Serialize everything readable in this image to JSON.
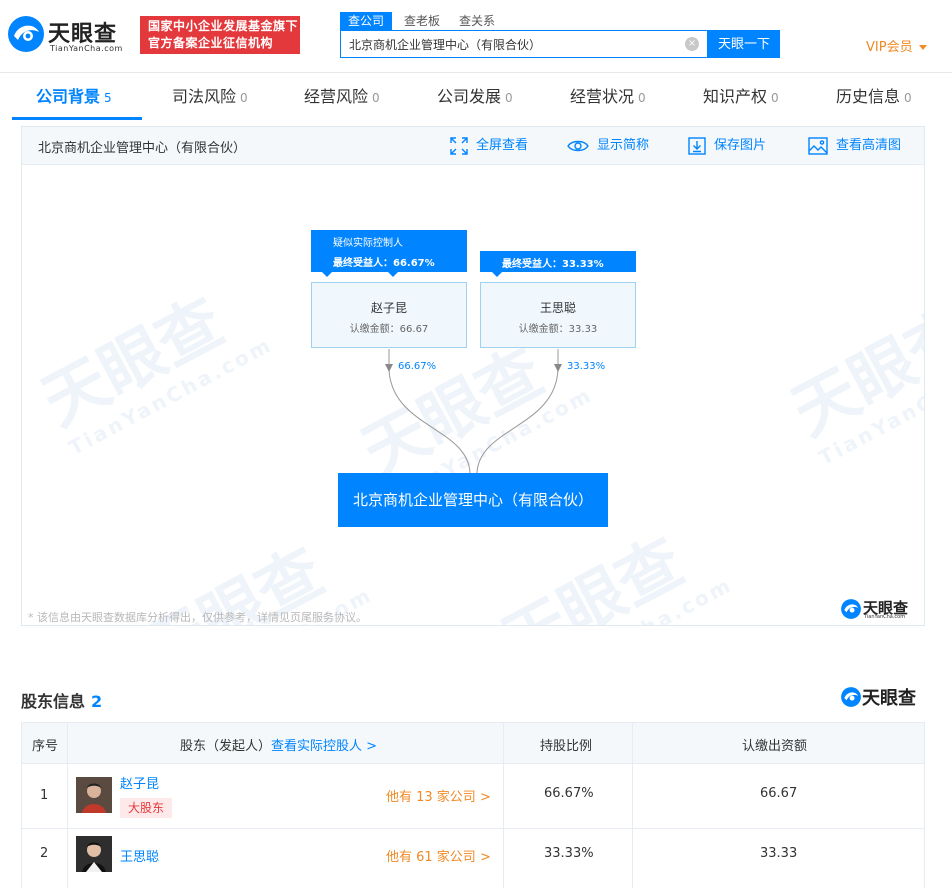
{
  "header": {
    "logo_name": "天眼查",
    "logo_sub": "TianYanCha.com",
    "badge_line1": "国家中小企业发展基金旗下",
    "badge_line2": "官方备案企业征信机构",
    "search_tabs": [
      "查公司",
      "查老板",
      "查关系"
    ],
    "search_value": "北京商机企业管理中心（有限合伙）",
    "search_clear": "×",
    "search_button": "天眼一下",
    "vip_label": "VIP会员"
  },
  "nav": {
    "tabs": [
      {
        "label": "公司背景",
        "count": "5"
      },
      {
        "label": "司法风险",
        "count": "0"
      },
      {
        "label": "经营风险",
        "count": "0"
      },
      {
        "label": "公司发展",
        "count": "0"
      },
      {
        "label": "经营状况",
        "count": "0"
      },
      {
        "label": "知识产权",
        "count": "0"
      },
      {
        "label": "历史信息",
        "count": "0"
      }
    ]
  },
  "graph": {
    "title": "北京商机企业管理中心（有限合伙）",
    "tools": [
      "全屏查看",
      "显示简称",
      "保存图片",
      "查看高清图"
    ],
    "controller_tag": "疑似实际控制人",
    "beneficiaries": [
      {
        "tag": "最终受益人：66.67%",
        "name": "赵子昆",
        "amount": "认缴金额：66.67",
        "pct": "66.67%"
      },
      {
        "tag": "最终受益人：33.33%",
        "name": "王思聪",
        "amount": "认缴金额：33.33",
        "pct": "33.33%"
      }
    ],
    "company": "北京商机企业管理中心（有限合伙）",
    "disclaimer": "* 该信息由天眼查数据库分析得出，仅供参考，详情见页尾服务协议。",
    "watermark": "天眼查",
    "watermark_sub": "TianYanCha.com"
  },
  "shareholders": {
    "title": "股东信息",
    "count": "2",
    "headers": {
      "index": "序号",
      "holder": "股东（发起人）",
      "holder_link": "查看实际控股人 >",
      "ratio": "持股比例",
      "capital": "认缴出资额"
    },
    "rows": [
      {
        "index": "1",
        "name": "赵子昆",
        "tag": "大股东",
        "companies": "他有 13 家公司 >",
        "ratio": "66.67%",
        "capital": "66.67"
      },
      {
        "index": "2",
        "name": "王思聪",
        "tag": "",
        "companies": "他有 61 家公司 >",
        "ratio": "33.33%",
        "capital": "33.33"
      }
    ]
  },
  "colors": {
    "accent": "#0084ff",
    "brand_red": "#e4393c",
    "vip_orange": "#f08a24"
  }
}
